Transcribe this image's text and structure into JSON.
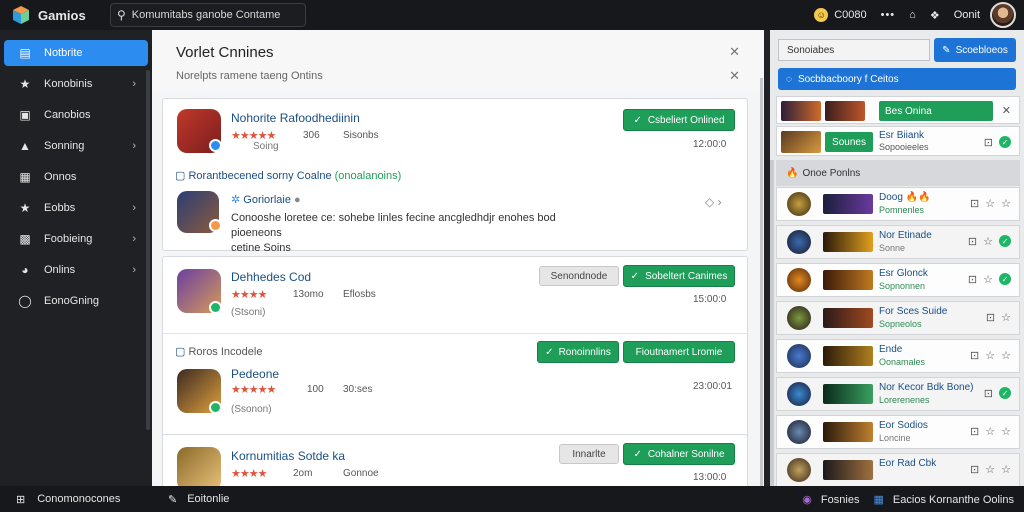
{
  "app": {
    "name": "Gamios"
  },
  "search": {
    "value": "Komumitabs ganobe Contame"
  },
  "topbar": {
    "coins": "C0080",
    "more": "•••",
    "user": "Oonit"
  },
  "sidebar": {
    "items": [
      {
        "label": "Notbrite",
        "icon": "list-icon",
        "chevron": false,
        "active": true
      },
      {
        "label": "Konobinis",
        "icon": "star-icon",
        "chevron": true
      },
      {
        "label": "Canobios",
        "icon": "card-icon",
        "chevron": false
      },
      {
        "label": "Sonning",
        "icon": "gamepad-icon",
        "chevron": true
      },
      {
        "label": "Onnos",
        "icon": "folder-icon",
        "chevron": false
      },
      {
        "label": "Eobbs",
        "icon": "star-icon",
        "chevron": true
      },
      {
        "label": "Foobieing",
        "icon": "box-icon",
        "chevron": true
      },
      {
        "label": "Onlins",
        "icon": "globe-icon",
        "chevron": true
      },
      {
        "label": "EonoGning",
        "icon": "circle-icon",
        "chevron": false
      }
    ]
  },
  "main": {
    "title": "Vorlet Cnnines",
    "subtitle": "Norelpts ramene taeng Ontins",
    "cards": [
      {
        "name": "Nohorite Rafoodhediinin",
        "stars": "★★★★★",
        "count": "306",
        "meta": "Sisonbs",
        "sub": "Soing",
        "button": "Csbeliert Onlined",
        "time": "12:00:0",
        "section_title": "Rorantbecened sorny Coalne",
        "section_highlight": "(onoalanoins)",
        "sub_game": "Goriorlaie",
        "desc_line1": "Conooshe loretee ce: sohebe linles fecine ancgledhdjr enohes bod pioeneons",
        "desc_line2": "cetine Soins"
      },
      {
        "name": "Dehhedes Cod",
        "stars": "★★★★",
        "count": "13omo",
        "meta": "Eflosbs",
        "sub": "(Stsoni)",
        "button_grey": "Senondnode",
        "button": "Sobeltert Canimes",
        "time": "15:00:0",
        "section_title": "Roros Incodele",
        "button2": "Ronoinnlins",
        "button3": "Fioutnamert Lromie"
      },
      {
        "name": "Pedeone",
        "stars": "★★★★★",
        "count": "100",
        "meta": "30:ses",
        "sub": "(Ssonon)",
        "time": "23:00:01"
      },
      {
        "name": "Kornumitias Sotde ka",
        "stars": "★★★★",
        "count": "2om",
        "meta": "Gonnoe",
        "button_grey": "Innarlte",
        "button": "Cohalner Sonilne",
        "time": "13:00:0"
      }
    ]
  },
  "right": {
    "search_value": "Sonoiabes",
    "search_button": "Scoebloeos",
    "bar": "Socbbacboory f Ceitos",
    "rows_top": [
      {
        "name": "Bes Onina",
        "sub": ""
      },
      {
        "name": "Esr Biiank",
        "sub": "Sopooieeles",
        "button": "Sounes"
      }
    ],
    "filter": "Onoe  Ponlns",
    "rows": [
      {
        "name": "Doog 🔥🔥",
        "sub": "Pomnenles"
      },
      {
        "name": "Nor Etinade",
        "sub": "Sonne"
      },
      {
        "name": "Esr Glonck",
        "sub": "Sopnonnen"
      },
      {
        "name": "For Sces Suide",
        "sub": "Sopneolos"
      },
      {
        "name": "Ende",
        "sub": "Oonamales"
      },
      {
        "name": "Nor Kecor Bdk Bone)",
        "sub": "Lorerenenes"
      },
      {
        "name": "Eor Sodios",
        "sub": "Loncine"
      },
      {
        "name": "Eor Rad Cbk",
        "sub": ""
      }
    ]
  },
  "footer": {
    "left": "Conomonocones",
    "mid": "Eoitonlie",
    "right1": "Fosnies",
    "right2": "Eacios  Kornanthe Oolins"
  },
  "colors": {
    "accent_blue": "#2d8cf0",
    "green": "#1f9e5a",
    "dark_bg": "#17181b"
  }
}
